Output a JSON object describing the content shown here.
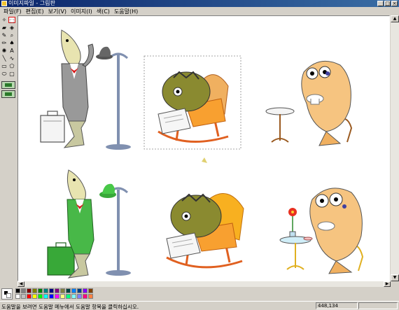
{
  "window": {
    "title": "이미지파일 - 그림판",
    "controls": [
      "_",
      "□",
      "×"
    ]
  },
  "menu": [
    "파일(F)",
    "편집(E)",
    "보기(V)",
    "이미지(I)",
    "색(C)",
    "도움말(H)"
  ],
  "tools": [
    {
      "name": "free-select-tool",
      "glyph": "✧"
    },
    {
      "name": "rect-select-tool",
      "glyph": "⬚"
    },
    {
      "name": "eraser-tool",
      "glyph": "▰"
    },
    {
      "name": "fill-tool",
      "glyph": "◈"
    },
    {
      "name": "color-picker-tool",
      "glyph": "✎"
    },
    {
      "name": "magnifier-tool",
      "glyph": "⌕"
    },
    {
      "name": "pencil-tool",
      "glyph": "✏"
    },
    {
      "name": "brush-tool",
      "glyph": "♠"
    },
    {
      "name": "airbrush-tool",
      "glyph": "✺"
    },
    {
      "name": "text-tool",
      "glyph": "A"
    },
    {
      "name": "line-tool",
      "glyph": "╲"
    },
    {
      "name": "curve-tool",
      "glyph": "∿"
    },
    {
      "name": "rectangle-tool",
      "glyph": "▭"
    },
    {
      "name": "polygon-tool",
      "glyph": "⬠"
    },
    {
      "name": "ellipse-tool",
      "glyph": "⬭"
    },
    {
      "name": "rounded-rect-tool",
      "glyph": "▢"
    }
  ],
  "selected_tool": "rect-select-tool",
  "palette": {
    "foreground": "#000000",
    "background": "#ffffff",
    "colors": [
      "#000000",
      "#808080",
      "#800000",
      "#808000",
      "#008000",
      "#008080",
      "#000080",
      "#800080",
      "#808040",
      "#004040",
      "#0080ff",
      "#004080",
      "#8000ff",
      "#804000",
      "#ffffff",
      "#c0c0c0",
      "#ff0000",
      "#ffff00",
      "#00ff00",
      "#00ffff",
      "#0000ff",
      "#ff00ff",
      "#ffff80",
      "#00ff80",
      "#80ffff",
      "#8080ff",
      "#ff0080",
      "#ff8040"
    ]
  },
  "status": {
    "help_text": "도움말을 보려면 도움말 메뉴에서 도움말 항목을 클릭하십시오.",
    "coords": "448,134",
    "extra": ""
  },
  "canvas": {
    "background": "#ffffff",
    "images": [
      "businessman-fish",
      "reading-fish-rocking-chair",
      "coffee-fish-table",
      "businessman-fish-green",
      "reading-fish-rocking-chair-2",
      "coffee-fish-flower-table"
    ]
  }
}
